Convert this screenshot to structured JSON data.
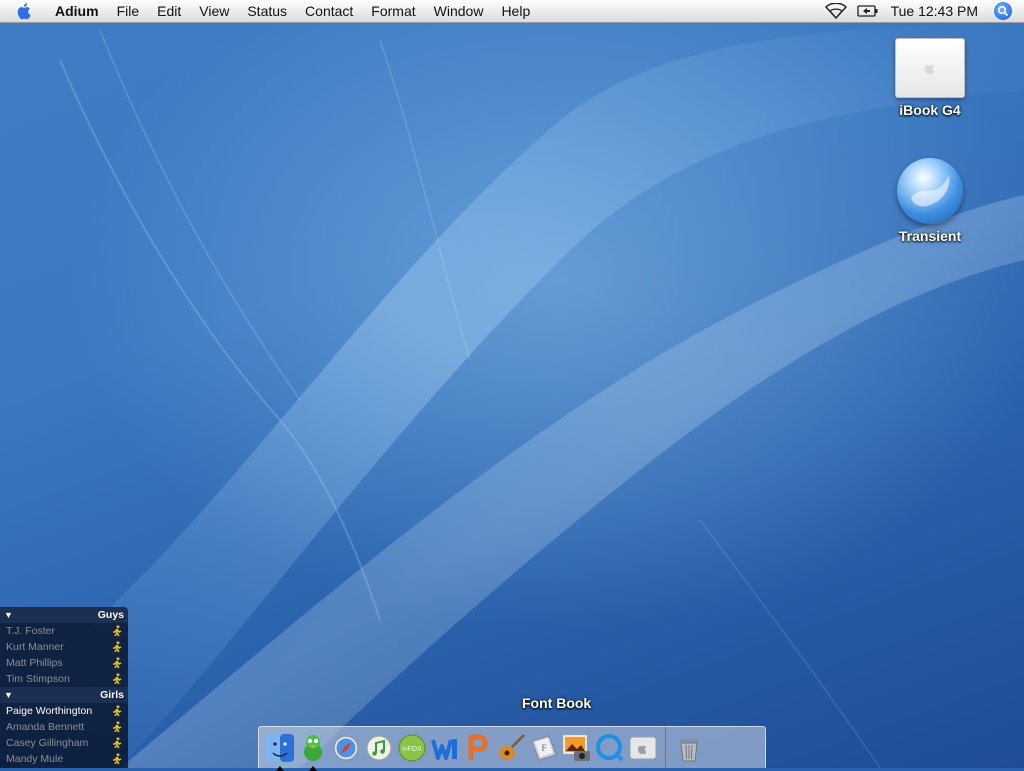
{
  "menubar": {
    "apple_icon": "apple-logo-icon",
    "app_name": "Adium",
    "menus": [
      "File",
      "Edit",
      "View",
      "Status",
      "Contact",
      "Format",
      "Window",
      "Help"
    ],
    "clock": "Tue 12:43 PM",
    "status_icons": [
      "wifi-icon",
      "battery-icon",
      "spotlight-icon"
    ]
  },
  "desktop": {
    "icons": [
      {
        "label": "iBook G4",
        "icon": "hard-drive-icon"
      },
      {
        "label": "Transient",
        "icon": "network-volume-icon"
      }
    ]
  },
  "buddy_list": {
    "groups": [
      {
        "name": "Guys",
        "buddies": [
          {
            "name": "T.J. Foster",
            "active": false
          },
          {
            "name": "Kurt Manner",
            "active": false
          },
          {
            "name": "Matt Phillips",
            "active": false
          },
          {
            "name": "Tim Stimpson",
            "active": false
          }
        ]
      },
      {
        "name": "Girls",
        "buddies": [
          {
            "name": "Paige Worthington",
            "active": true
          },
          {
            "name": "Amanda Bennett",
            "active": false
          },
          {
            "name": "Casey Gillingham",
            "active": false
          },
          {
            "name": "Mandy Mule",
            "active": false
          }
        ]
      }
    ],
    "status_icon": "away-runner-icon"
  },
  "dock": {
    "tooltip": "Font Book",
    "items": [
      {
        "icon": "finder-icon",
        "running": true
      },
      {
        "icon": "adium-icon",
        "running": true
      },
      {
        "icon": "safari-icon",
        "running": false
      },
      {
        "icon": "itunes-icon",
        "running": false
      },
      {
        "icon": "ivfox-icon",
        "running": false
      },
      {
        "icon": "word-icon",
        "running": false
      },
      {
        "icon": "powerpoint-icon",
        "running": false
      },
      {
        "icon": "garageband-icon",
        "running": false
      },
      {
        "icon": "font-book-icon",
        "running": false
      },
      {
        "icon": "iphoto-icon",
        "running": false
      },
      {
        "icon": "quicktime-icon",
        "running": false
      },
      {
        "icon": "system-preferences-icon",
        "running": false
      }
    ],
    "trash_icon": "trash-icon"
  },
  "colors": {
    "desktop": "#2f6bb5",
    "buddy_list_bg": "#0a1630",
    "active_buddy": "#ffffff",
    "idle_buddy": "#8a8f9a",
    "runner": "#f2c200"
  }
}
